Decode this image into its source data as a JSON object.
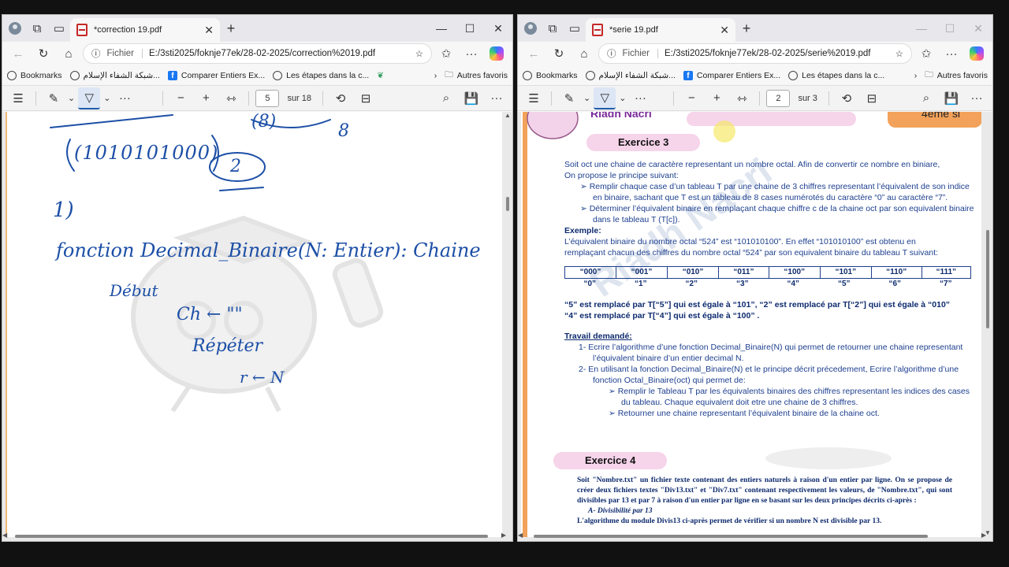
{
  "left": {
    "tab_title": "*correction 19.pdf",
    "address_prefix": "Fichier",
    "url": "E:/3sti2025/foknje77ek/28-02-2025/correction%2019.pdf",
    "bookmarks": [
      "Bookmarks",
      "شبكة الشفاء الإسلام...",
      "Comparer Entiers Ex...",
      "Les étapes dans la c..."
    ],
    "other_favorites": "Autres favoris",
    "page_current": "5",
    "page_total": "sur 18",
    "handwriting": {
      "binary": "(1010101000)",
      "base2": "2",
      "part": "1)",
      "func": "fonction Decimal_Binaire(N: Entier): Chaine",
      "debut": "Début",
      "ch": "Ch ← \"\"",
      "repeter": "Répéter",
      "r": "r ← N",
      "top": "(8)",
      "top2": "8"
    }
  },
  "right": {
    "tab_title": "*serie 19.pdf",
    "address_prefix": "Fichier",
    "url": "E:/3sti2025/foknje77ek/28-02-2025/serie%2019.pdf",
    "bookmarks": [
      "Bookmarks",
      "شبكة الشفاء الإسلام...",
      "Comparer Entiers Ex...",
      "Les étapes dans la c..."
    ],
    "other_favorites": "Autres favoris",
    "page_current": "2",
    "page_total": "sur 3",
    "doc": {
      "header_name": "Riadh Nacri",
      "header_class": "4eme si",
      "ex3_title": "Exercice 3",
      "intro1": "Soit oct une chaine de caractère representant un nombre octal. Afin de convertir ce nombre en biniare,",
      "intro2": "On propose le principe suivant:",
      "b1": "Remplir chaque case d’un tableau T par une chaine de 3 chiffres representant l’équivalent de son indice en binaire, sachant que T est un tableau de 8 cases numérotés du caractère “0” au caractère “7”.",
      "b2": "Déterminer l’équivalent binaire en remplaçant chaque chiffre c de la chaine oct par son equivalent binaire dans le tableau T (T[c]).",
      "exemple_label": "Exemple:",
      "ex_line1": "L’équivalent binaire du nombre octal “524” est “101010100”. En effet “101010100” est obtenu en",
      "ex_line2": "remplaçant chacun des chiffres du nombre octal “524” par son equivalent binaire du tableau T suivant:",
      "table_values": [
        "“000”",
        "“001”",
        "“010”",
        "“011”",
        "“100”",
        "“101”",
        "“110”",
        "“111”"
      ],
      "table_indices": [
        "“0”",
        "“1”",
        "“2”",
        "“3”",
        "“4”",
        "“5”",
        "“6”",
        "“7”"
      ],
      "repl1": "“5” est remplacé par T[“5”] qui est égale à “101”, “2” est remplacé par T[“2”] qui est égale à “010”",
      "repl2": "“4” est remplacé par T[“4”] qui est égale à “100” .",
      "travail": "Travail demandé:",
      "t1": "1-  Ecrire l’algorithme d’une fonction Decimal_Binaire(N) qui permet de retourner une chaine representant l’équivalent binaire d’un entier decimal N.",
      "t2": "2-  En utilisant la fonction Decimal_Binaire(N) et le principe décrit précedement, Ecrire l’algorithme d’une fonction Octal_Binaire(oct) qui permet de:",
      "t2a": "Remplir le Tableau T par les équivalents binaires des chiffres representant les indices des cases du tableau. Chaque equivalent doit etre une chaine de 3 chiffres.",
      "t2b": "Retourner une chaine representant l’équivalent binaire de la chaine oct.",
      "ex4_title": "Exercice 4",
      "ex4_p1": "Soit \"Nombre.txt\" un fichier texte contenant des entiers naturels à raison d'un entier par ligne. On se propose de créer deux fichiers textes \"Div13.txt\" et \"Div7.txt\" contenant respectivement les valeurs, de \"Nombre.txt\", qui sont divisibles par 13 et par 7 à raison d'un entier par ligne en se basant sur les deux principes décrits ci-après :",
      "ex4_a": "A-  Divisibilité par 13",
      "ex4_p2": "L'algorithme du module Divis13 ci-après permet de vérifier si un nombre N est divisible par 13.",
      "watermark": "Riadh Nacri"
    }
  }
}
